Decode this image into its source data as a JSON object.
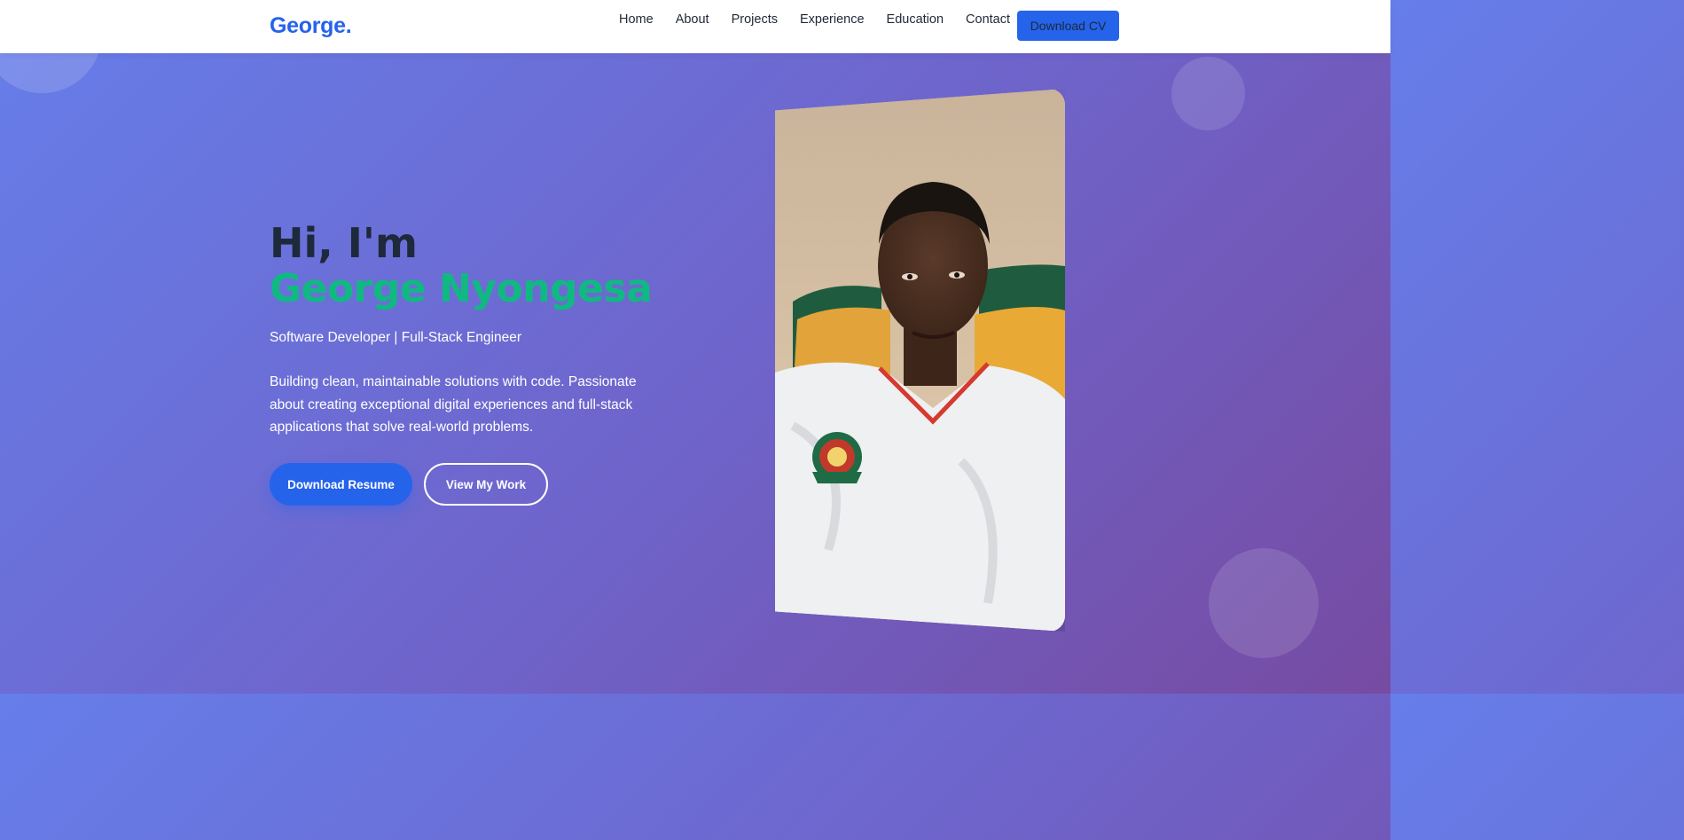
{
  "nav": {
    "logo": "George",
    "logo_dot": ".",
    "links": [
      "Home",
      "About",
      "Projects",
      "Experience",
      "Education",
      "Contact"
    ],
    "cv_button": "Download CV"
  },
  "hero": {
    "greeting": "Hi, I'm",
    "name": "George Nyongesa",
    "role": "Software Developer | Full-Stack Engineer",
    "description": "Building clean, maintainable solutions with code. Passionate about creating exceptional digital experiences and full-stack applications that solve real-world problems.",
    "primary_button": "Download Resume",
    "secondary_button": "View My Work"
  },
  "colors": {
    "brand": "#2563eb",
    "accent": "#10b981",
    "gradient_start": "#667eea",
    "gradient_end": "#764ba2"
  }
}
